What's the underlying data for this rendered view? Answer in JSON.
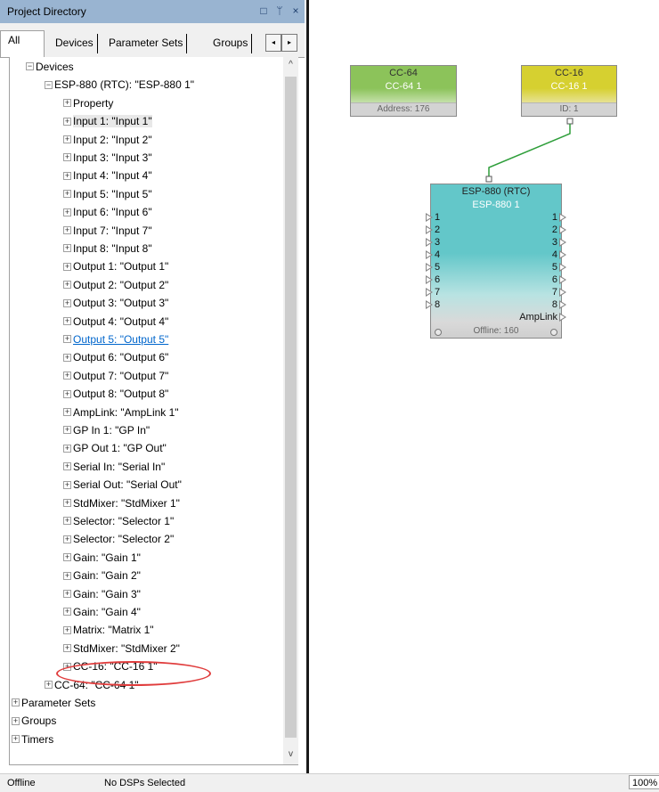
{
  "panel": {
    "title": "Project Directory",
    "title_buttons": [
      "□",
      "ᛘ",
      "×"
    ],
    "tabs": [
      "All",
      "Devices",
      "Parameter Sets",
      "Groups"
    ],
    "tab_scroll": [
      "◂",
      "▸"
    ]
  },
  "tree": [
    {
      "label": "Devices",
      "sign": "−"
    },
    {
      "label": "ESP-880 (RTC): \"ESP-880 1\"",
      "sign": "−"
    },
    {
      "label": "Property",
      "sign": "+"
    },
    {
      "label": "Input 1: \"Input 1\"",
      "sign": "+"
    },
    {
      "label": "Input 2: \"Input 2\"",
      "sign": "+"
    },
    {
      "label": "Input 3: \"Input 3\"",
      "sign": "+"
    },
    {
      "label": "Input 4: \"Input 4\"",
      "sign": "+"
    },
    {
      "label": "Input 5: \"Input 5\"",
      "sign": "+"
    },
    {
      "label": "Input 6: \"Input 6\"",
      "sign": "+"
    },
    {
      "label": "Input 7: \"Input 7\"",
      "sign": "+"
    },
    {
      "label": "Input 8: \"Input 8\"",
      "sign": "+"
    },
    {
      "label": "Output 1: \"Output 1\"",
      "sign": "+"
    },
    {
      "label": "Output 2: \"Output 2\"",
      "sign": "+"
    },
    {
      "label": "Output 3: \"Output 3\"",
      "sign": "+"
    },
    {
      "label": "Output 4: \"Output 4\"",
      "sign": "+"
    },
    {
      "label": "Output 5: \"Output 5\"",
      "sign": "+"
    },
    {
      "label": "Output 6: \"Output 6\"",
      "sign": "+"
    },
    {
      "label": "Output 7: \"Output 7\"",
      "sign": "+"
    },
    {
      "label": "Output 8: \"Output 8\"",
      "sign": "+"
    },
    {
      "label": "AmpLink: \"AmpLink 1\"",
      "sign": "+"
    },
    {
      "label": "GP In 1: \"GP In\"",
      "sign": "+"
    },
    {
      "label": "GP Out 1: \"GP Out\"",
      "sign": "+"
    },
    {
      "label": "Serial In: \"Serial In\"",
      "sign": "+"
    },
    {
      "label": "Serial Out: \"Serial Out\"",
      "sign": "+"
    },
    {
      "label": "StdMixer: \"StdMixer 1\"",
      "sign": "+"
    },
    {
      "label": "Selector: \"Selector 1\"",
      "sign": "+"
    },
    {
      "label": "Selector: \"Selector 2\"",
      "sign": "+"
    },
    {
      "label": "Gain: \"Gain 1\"",
      "sign": "+"
    },
    {
      "label": "Gain: \"Gain 2\"",
      "sign": "+"
    },
    {
      "label": "Gain: \"Gain 3\"",
      "sign": "+"
    },
    {
      "label": "Gain: \"Gain 4\"",
      "sign": "+"
    },
    {
      "label": "Matrix: \"Matrix 1\"",
      "sign": "+"
    },
    {
      "label": "StdMixer: \"StdMixer 2\"",
      "sign": "+"
    },
    {
      "label": "CC-16: \"CC-16 1\"",
      "sign": "+"
    },
    {
      "label": "CC-64: \"CC-64 1\"",
      "sign": "+"
    },
    {
      "label": "Parameter Sets",
      "sign": "+"
    },
    {
      "label": "Groups",
      "sign": "+"
    },
    {
      "label": "Timers",
      "sign": "+"
    }
  ],
  "scroll": {
    "up": "^",
    "down": "v"
  },
  "canvas": {
    "cc64": {
      "type": "CC-64",
      "name": "CC-64 1",
      "footer": "Address: 176",
      "color": "#8cc35a"
    },
    "cc16": {
      "type": "CC-16",
      "name": "CC-16 1",
      "footer": "ID: 1",
      "color": "#d6d030"
    },
    "esp": {
      "type": "ESP-880 (RTC)",
      "name": "ESP-880 1",
      "inputs": [
        "1",
        "2",
        "3",
        "4",
        "5",
        "6",
        "7",
        "8"
      ],
      "outputs": [
        "1",
        "2",
        "3",
        "4",
        "5",
        "6",
        "7",
        "8",
        "AmpLink"
      ],
      "status": "Offline: 160",
      "color": "#63c7c9"
    },
    "wire_color": "#2e9e3a"
  },
  "statusbar": {
    "state": "Offline",
    "message": "No DSPs Selected",
    "zoom": "100%"
  }
}
